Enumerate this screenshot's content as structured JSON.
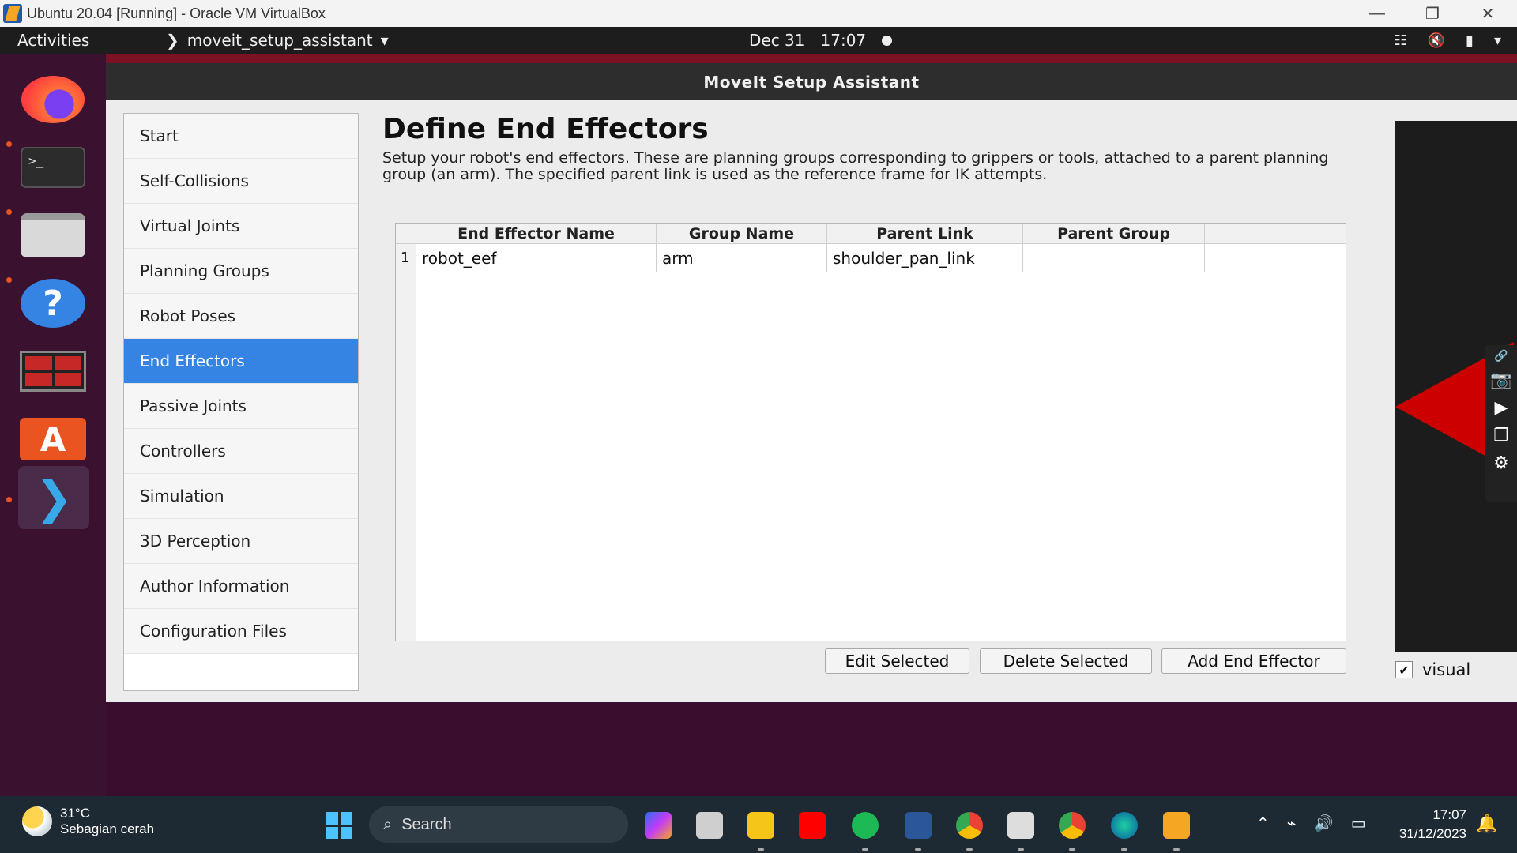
{
  "vbox": {
    "title": "Ubuntu 20.04 [Running] - Oracle VM VirtualBox",
    "minimize": "—",
    "restore": "❐",
    "close": "✕"
  },
  "ubuntu_bar": {
    "activities": "Activities",
    "app_name": "moveit_setup_assistant",
    "date": "Dec 31",
    "time": "17:07",
    "tray_icons": [
      "network-icon",
      "volume-muted-icon",
      "battery-icon",
      "menu-arrow-icon"
    ]
  },
  "dock": {
    "apps": [
      "Firefox",
      "Terminal",
      "Files",
      "Help",
      "RViz",
      "Ubuntu Software",
      "MoveIt Setup Assistant"
    ]
  },
  "app": {
    "window_title": "MoveIt Setup Assistant",
    "nav": [
      "Start",
      "Self-Collisions",
      "Virtual Joints",
      "Planning Groups",
      "Robot Poses",
      "End Effectors",
      "Passive Joints",
      "Controllers",
      "Simulation",
      "3D Perception",
      "Author Information",
      "Configuration Files"
    ],
    "active_nav": "End Effectors",
    "page_title": "Define End Effectors",
    "page_desc": "Setup your robot's end effectors. These are planning groups corresponding to grippers or tools, attached to a parent planning group (an arm). The specified parent link is used as the reference frame for IK attempts.",
    "table": {
      "columns": [
        "End Effector Name",
        "Group Name",
        "Parent Link",
        "Parent Group"
      ],
      "rows": [
        {
          "index": "1",
          "cells": [
            "robot_eef",
            "arm",
            "shoulder_pan_link",
            ""
          ]
        }
      ]
    },
    "buttons": {
      "edit": "Edit Selected",
      "delete": "Delete Selected",
      "add": "Add End Effector"
    },
    "visual_label": "visual",
    "visual_checked": true
  },
  "taskbar": {
    "temperature": "31°C",
    "weather": "Sebagian cerah",
    "search": "Search",
    "time": "17:07",
    "date": "31/12/2023"
  },
  "colors": {
    "accent": "#3584e4",
    "ubuntu_orange": "#e95420",
    "header_bg": "#2d2d2d",
    "taskbar_bg": "#1e2a33"
  }
}
